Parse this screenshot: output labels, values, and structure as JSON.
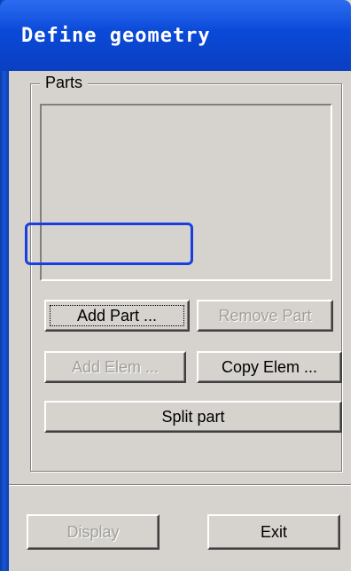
{
  "window": {
    "title": "Define geometry"
  },
  "parts_group": {
    "label": "Parts",
    "list_items": []
  },
  "buttons": {
    "add_part": {
      "label": "Add Part ...",
      "enabled": true
    },
    "remove_part": {
      "label": "Remove Part",
      "enabled": false
    },
    "add_elem": {
      "label": "Add Elem ...",
      "enabled": false
    },
    "copy_elem": {
      "label": "Copy Elem ...",
      "enabled": true
    },
    "split_part": {
      "label": "Split part",
      "enabled": true
    },
    "display": {
      "label": "Display",
      "enabled": false
    },
    "exit": {
      "label": "Exit",
      "enabled": true
    }
  },
  "colors": {
    "titlebar": "#0a49d8",
    "dialog_bg": "#d6d3ce",
    "highlight": "#1a3fe0",
    "disabled_text": "#a19f9b"
  }
}
